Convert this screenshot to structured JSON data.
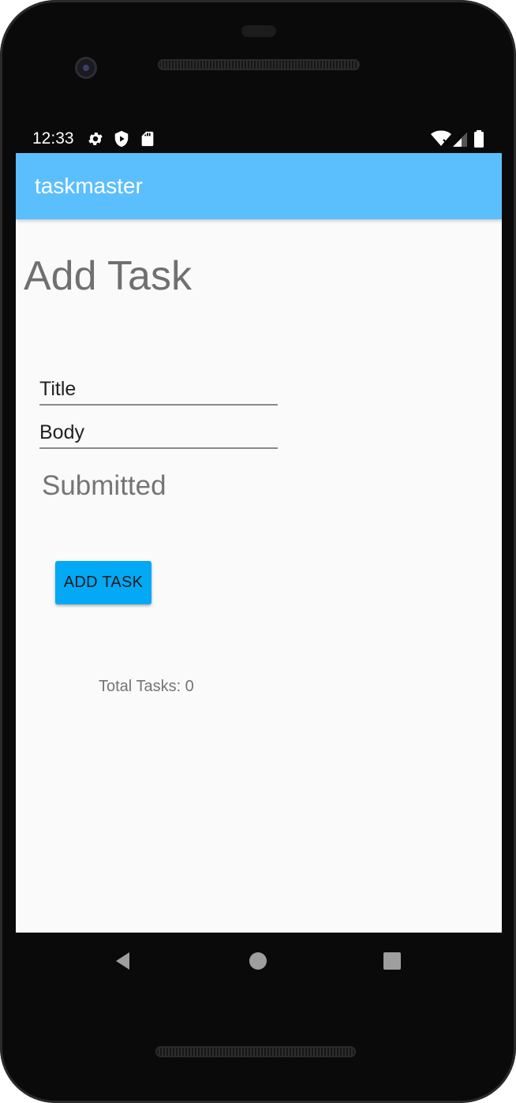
{
  "status_bar": {
    "time": "12:33",
    "left_icons": [
      "gear-icon",
      "shield-play-icon",
      "sd-card-icon"
    ],
    "right_icons": [
      "wifi-off-icon",
      "cell-signal-icon",
      "battery-icon"
    ]
  },
  "app_bar": {
    "title": "taskmaster",
    "color": "#5bbffd"
  },
  "main": {
    "heading": "Add Task",
    "title_field": {
      "placeholder": "Title",
      "value": ""
    },
    "body_field": {
      "placeholder": "Body",
      "value": ""
    },
    "status_text": "Submitted",
    "add_button_label": "ADD TASK",
    "add_button_color": "#03a9f4",
    "total_tasks": "Total Tasks: 0"
  },
  "nav_bar": {
    "buttons": [
      "back-icon",
      "home-icon",
      "recents-icon"
    ]
  }
}
